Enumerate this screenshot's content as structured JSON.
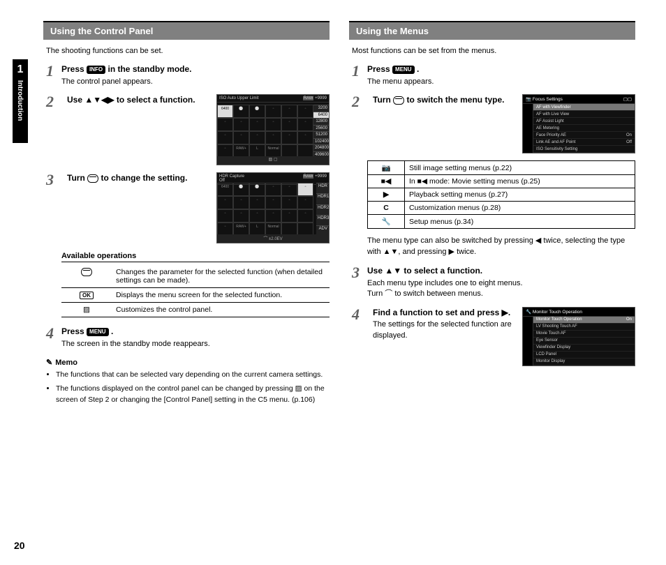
{
  "page_number": "20",
  "chapter": {
    "number": "1",
    "title": "Introduction"
  },
  "left": {
    "header": "Using the Control Panel",
    "intro": "The shooting functions can be set.",
    "steps": [
      {
        "title_pre": "Press ",
        "btn": "INFO",
        "title_post": " in the standby mode.",
        "desc": "The control panel appears."
      },
      {
        "title": "Use ▲▼◀▶ to select a function."
      },
      {
        "title_pre": "Turn ",
        "title_post": " to change the setting."
      },
      {
        "title_pre": "Press ",
        "btn": "MENU",
        "title_post": ".",
        "desc": "The screen in the standby mode reappears."
      }
    ],
    "ops_header": "Available operations",
    "ops": [
      {
        "icon": "dial",
        "text": "Changes the parameter for the selected function (when detailed settings can be made)."
      },
      {
        "icon": "OK",
        "text": "Displays the menu screen for the selected function."
      },
      {
        "icon": "ev",
        "text": "Customizes the control panel."
      }
    ],
    "memo_title": "Memo",
    "memo": [
      "The functions that can be selected vary depending on the current camera settings.",
      "The functions displayed on the control panel can be changed by pressing ▨ on the screen of Step 2 or changing the [Control Panel] setting in the C5 menu. (p.106)"
    ],
    "lcd1": {
      "title": "ISO Auto Upper Limit",
      "counts": "+9999",
      "side": [
        "3200",
        "6400",
        "12800",
        "25600",
        "51200",
        "102400",
        "204800",
        "409600"
      ],
      "sel": "6400"
    },
    "lcd2": {
      "title": "HDR Capture",
      "sub": "Off",
      "counts": "+9999",
      "bottom": "±2.0EV",
      "sel": "6400"
    }
  },
  "right": {
    "header": "Using the Menus",
    "intro": "Most functions can be set from the menus.",
    "steps": [
      {
        "title_pre": "Press ",
        "btn": "MENU",
        "title_post": ".",
        "desc": "The menu appears."
      },
      {
        "title_pre": "Turn ",
        "title_post": " to switch the menu type."
      },
      {
        "title": "Use ▲▼ to select a function.",
        "desc": "Each menu type includes one to eight menus.\nTurn ⌒ to switch between menus."
      },
      {
        "title": "Find a function to set and press ▶.",
        "desc": "The settings for the selected function are displayed."
      }
    ],
    "menu_types": [
      {
        "icon": "📷",
        "text": "Still image setting menus (p.22)"
      },
      {
        "icon": "■◀",
        "text": "In ■◀ mode: Movie setting menus (p.25)"
      },
      {
        "icon": "▶",
        "text": "Playback setting menus (p.27)"
      },
      {
        "icon": "C",
        "text": "Customization menus (p.28)"
      },
      {
        "icon": "🔧",
        "text": "Setup menus (p.34)"
      }
    ],
    "switch_note": "The menu type can also be switched by pressing ◀ twice, selecting the type with ▲▼, and pressing ▶ twice.",
    "menu1": {
      "title": "Focus Settings",
      "items": [
        {
          "l": "AF with Viewfinder",
          "r": ""
        },
        {
          "l": "AF with Live View",
          "r": ""
        },
        {
          "l": "AF Assist Light",
          "r": ""
        },
        {
          "l": "AE Metering",
          "r": ""
        },
        {
          "l": "Face Priority AE",
          "r": "On"
        },
        {
          "l": "Link AE and AF Point",
          "r": "Off"
        },
        {
          "l": "ISO Sensitivity Setting",
          "r": ""
        }
      ]
    },
    "menu2": {
      "title": "Monitor Touch Operation",
      "items": [
        {
          "l": "Monitor Touch Operation",
          "r": "On"
        },
        {
          "l": "LV Shooting Touch AF",
          "r": ""
        },
        {
          "l": "Movie Touch AF",
          "r": ""
        },
        {
          "l": "Eye Sensor",
          "r": ""
        },
        {
          "l": "Viewfinder Display",
          "r": ""
        },
        {
          "l": "LCD Panel",
          "r": ""
        },
        {
          "l": "Monitor Display",
          "r": ""
        }
      ]
    }
  }
}
